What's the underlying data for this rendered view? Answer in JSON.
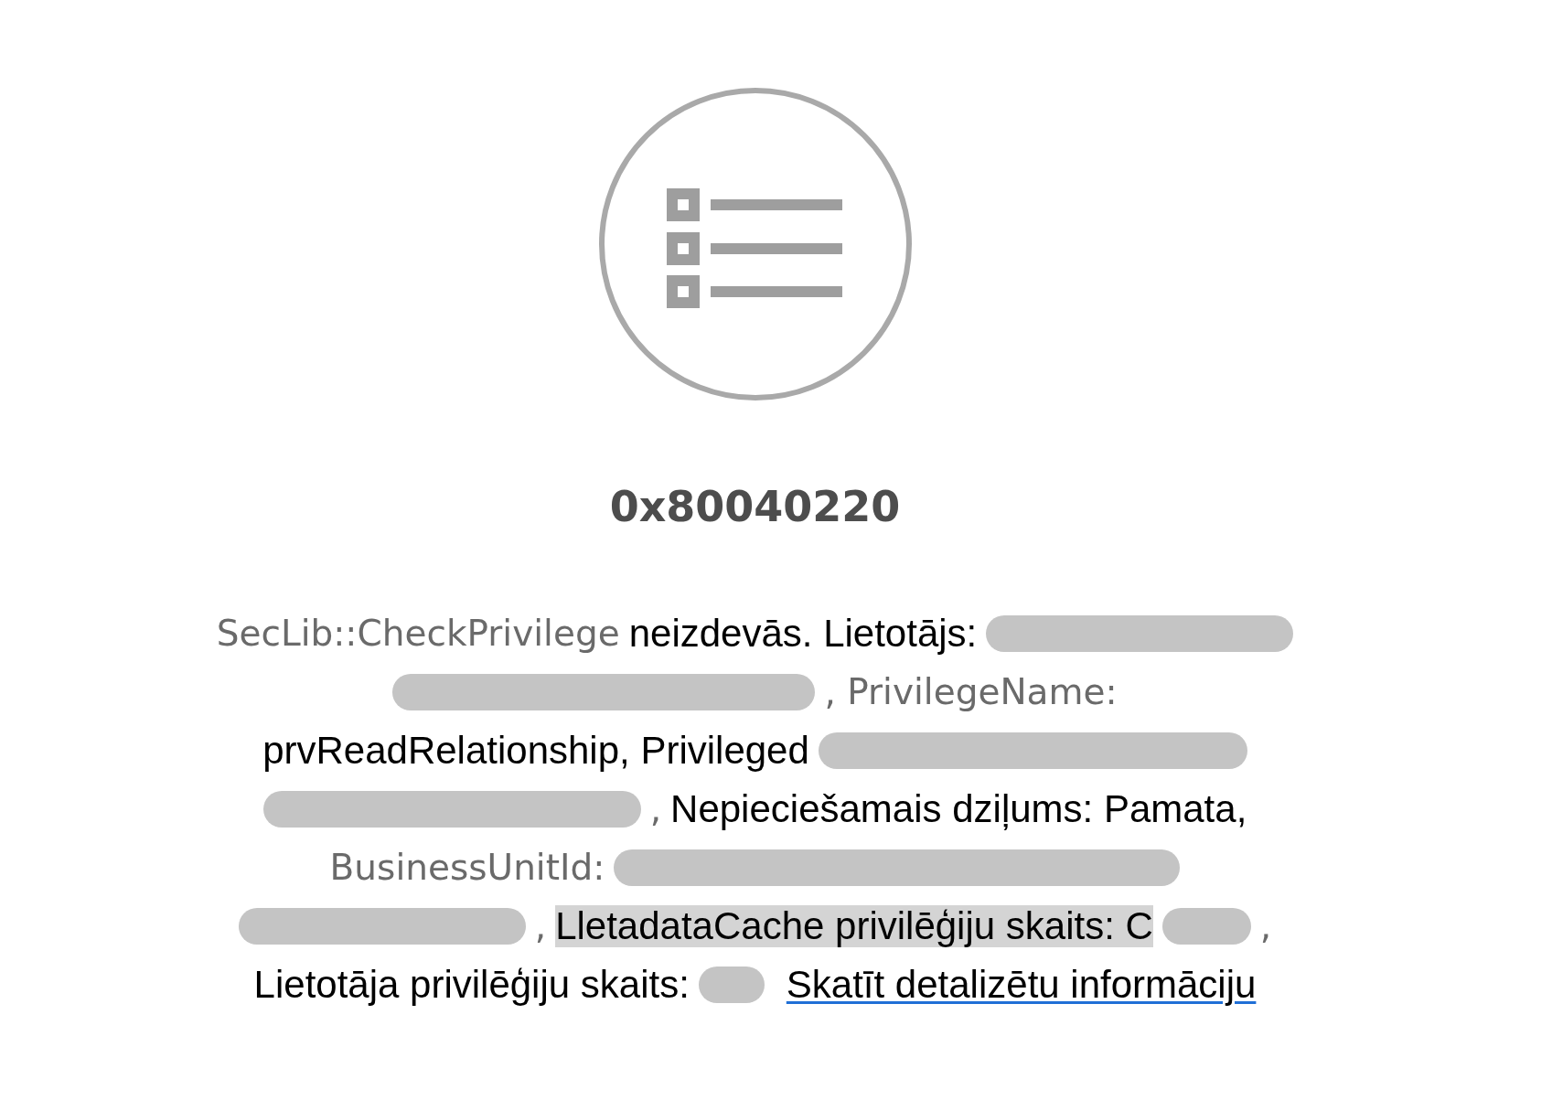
{
  "error": {
    "code": "0x80040220",
    "message_lines": [
      {
        "segments": [
          {
            "kind": "faded",
            "text": "SecLib::CheckPrivilege"
          },
          {
            "kind": "text",
            "text": "neizdevās. Lietotājs:"
          },
          {
            "kind": "redacted"
          }
        ]
      },
      {
        "segments": [
          {
            "kind": "redacted"
          },
          {
            "kind": "faded",
            "text": ", PrivilegeName:"
          }
        ]
      },
      {
        "segments": [
          {
            "kind": "text",
            "text": "prvReadRelationship, Privileged"
          },
          {
            "kind": "redacted"
          }
        ]
      },
      {
        "segments": [
          {
            "kind": "redacted"
          },
          {
            "kind": "faded",
            "text": ","
          },
          {
            "kind": "text",
            "text": "Nepieciešamais dziļums: Pamata,"
          }
        ]
      },
      {
        "segments": [
          {
            "kind": "faded",
            "text": "BusinessUnitId:"
          },
          {
            "kind": "redacted"
          }
        ]
      },
      {
        "segments": [
          {
            "kind": "redacted"
          },
          {
            "kind": "faded",
            "text": ","
          },
          {
            "kind": "highlighted",
            "text": "LletadataCache privilēģiju skaits: C"
          },
          {
            "kind": "redacted"
          },
          {
            "kind": "faded",
            "text": ","
          }
        ]
      },
      {
        "segments": [
          {
            "kind": "text",
            "text": "Lietotāja privilēģiju skaits:"
          },
          {
            "kind": "redacted"
          },
          {
            "kind": "link",
            "text": "Skatīt detalizētu informāciju"
          }
        ]
      }
    ]
  }
}
